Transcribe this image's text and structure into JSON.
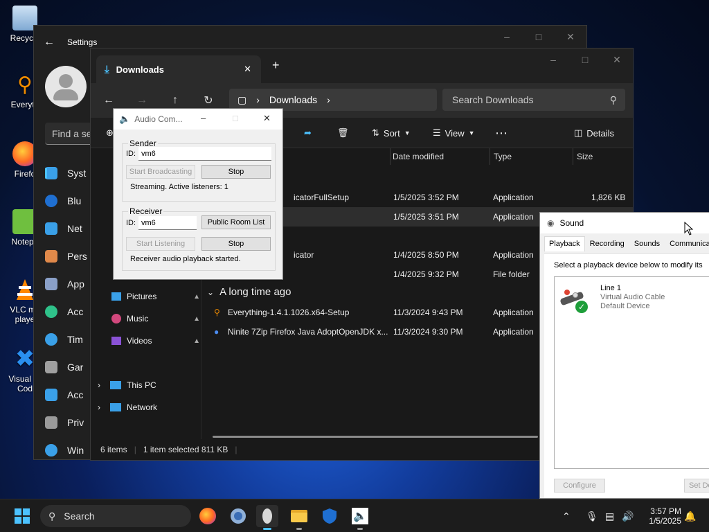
{
  "desktop": {
    "icons": [
      {
        "label": "Recycle",
        "icon": "recycle-bin-icon"
      },
      {
        "label": "Everyth",
        "icon": "everything-search-icon"
      },
      {
        "label": "Firefo",
        "icon": "firefox-icon"
      },
      {
        "label": "Notepa",
        "icon": "notepad-icon"
      },
      {
        "label": "VLC me playe",
        "icon": "vlc-icon"
      },
      {
        "label": "Visual St Cod",
        "icon": "vscode-icon"
      }
    ]
  },
  "settings": {
    "title": "Settings",
    "search_placeholder": "Find a se",
    "nav": [
      "Syst",
      "Blu",
      "Net",
      "Pers",
      "App",
      "Acc",
      "Tim",
      "Gar",
      "Acc",
      "Priv",
      "Win"
    ]
  },
  "explorer": {
    "tab_title": "Downloads",
    "breadcrumb": "Downloads",
    "search_placeholder": "Search Downloads",
    "commands": {
      "sort": "Sort",
      "view": "View",
      "details": "Details"
    },
    "columns": {
      "date": "Date modified",
      "type": "Type",
      "size": "Size"
    },
    "rows": [
      {
        "name": "icatorFullSetup",
        "date": "1/5/2025 3:52 PM",
        "type": "Application",
        "size": "1,826 KB"
      },
      {
        "name": "",
        "date": "1/5/2025 3:51 PM",
        "type": "Application",
        "size": ""
      },
      {
        "name": "icator",
        "date": "1/4/2025 8:50 PM",
        "type": "Application",
        "size": ""
      },
      {
        "name": "",
        "date": "1/4/2025 9:32 PM",
        "type": "File folder",
        "size": ""
      }
    ],
    "group_old": "A long time ago",
    "old_rows": [
      {
        "name": "Everything-1.4.1.1026.x64-Setup",
        "date": "11/3/2024 9:43 PM",
        "type": "Application"
      },
      {
        "name": "Ninite 7Zip Firefox Java AdoptOpenJDK x...",
        "date": "11/3/2024 9:30 PM",
        "type": "Application"
      }
    ],
    "sidebar": [
      "Pictures",
      "Music",
      "Videos",
      "This PC",
      "Network"
    ],
    "status": {
      "items": "6 items",
      "selected": "1 item selected  811 KB"
    }
  },
  "audio": {
    "title": "Audio Com...",
    "sender": {
      "group": "Sender",
      "id_label": "ID:",
      "id_value": "vm6",
      "start_label": "Start Broadcasting",
      "stop_label": "Stop",
      "status": "Streaming. Active listeners: 1"
    },
    "receiver": {
      "group": "Receiver",
      "id_label": "ID:",
      "id_value": "vm6",
      "room_label": "Public Room List",
      "start_label": "Start Listening",
      "stop_label": "Stop",
      "status": "Receiver audio playback started."
    }
  },
  "sound": {
    "title": "Sound",
    "tabs": [
      "Playback",
      "Recording",
      "Sounds",
      "Communication"
    ],
    "instruction": "Select a playback device below to modify its",
    "device": {
      "name": "Line 1",
      "driver": "Virtual Audio Cable",
      "status": "Default Device"
    },
    "configure": "Configure",
    "set_default": "Set De"
  },
  "taskbar": {
    "search": "Search",
    "time": "3:57 PM",
    "date": "1/5/2025"
  },
  "colors": {
    "accent": "#0067c0",
    "green_check": "#1e9e3a"
  }
}
